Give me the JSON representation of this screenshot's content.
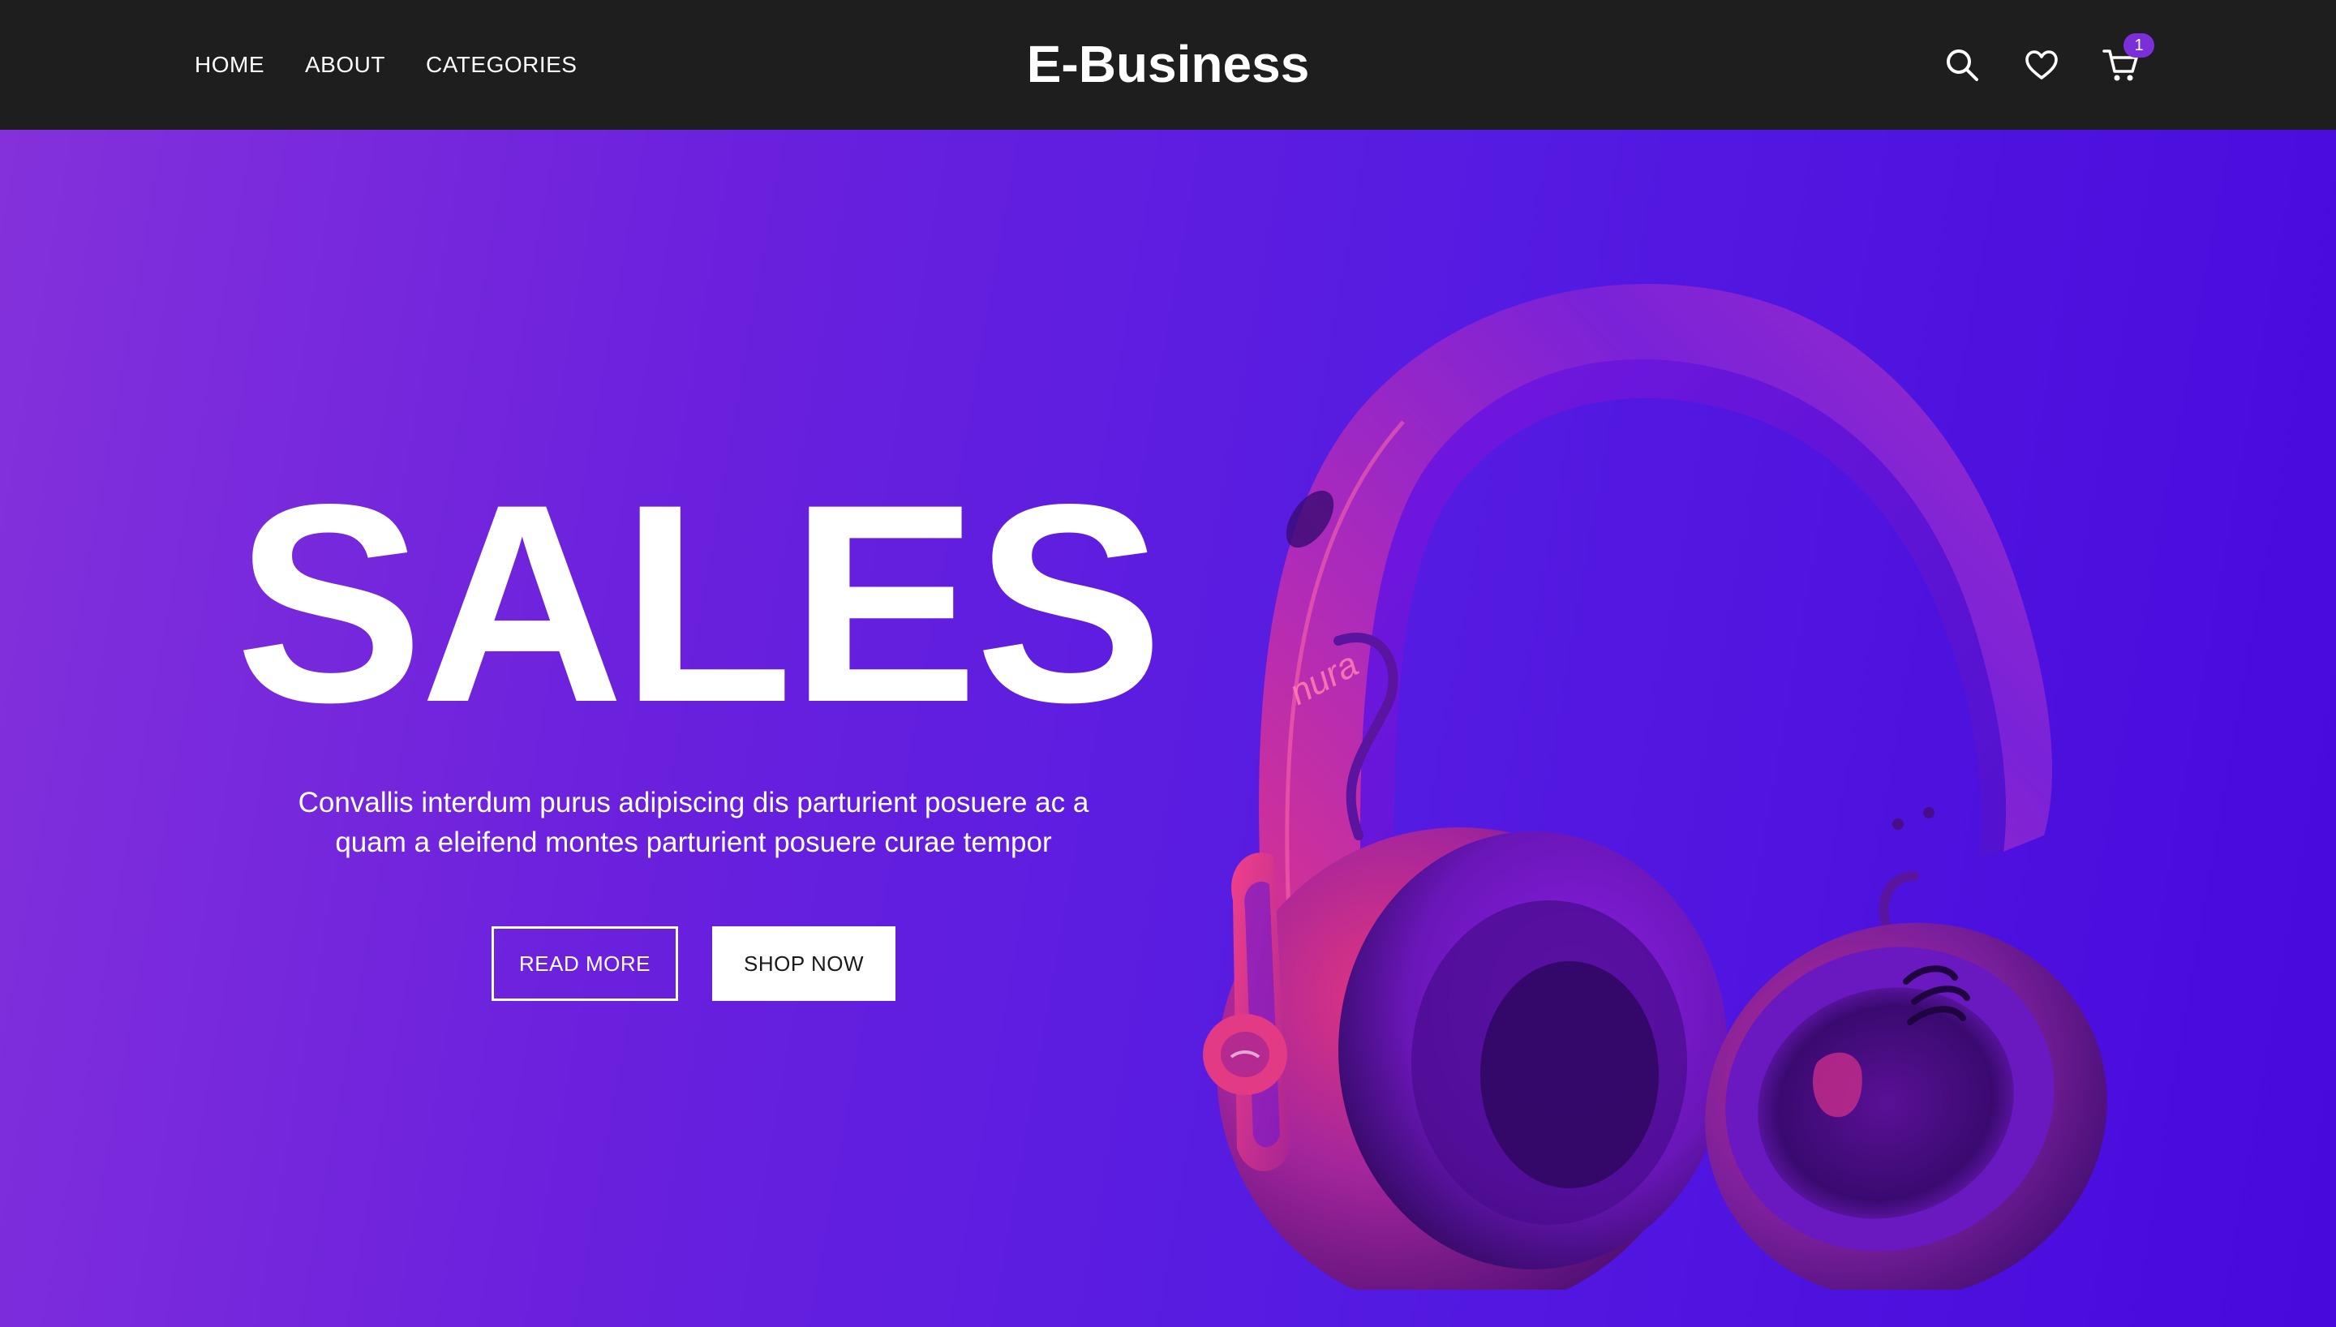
{
  "header": {
    "nav": [
      {
        "label": "HOME"
      },
      {
        "label": "ABOUT"
      },
      {
        "label": "CATEGORIES"
      }
    ],
    "brand": "E-Business",
    "icons": [
      "search-icon",
      "heart-icon",
      "cart-icon"
    ],
    "cart_count": "1"
  },
  "hero": {
    "headline": "SALES",
    "tagline": "Convallis interdum purus adipiscing dis parturient posuere ac a quam a eleifend montes parturient posuere curae tempor",
    "read_more_label": "READ MORE",
    "shop_now_label": "SHOP NOW",
    "product_logo": "nura"
  },
  "colors": {
    "header_bg": "#1e1e1e",
    "hero_gradient_start": "#8431db",
    "hero_gradient_end": "#4809dc",
    "badge": "#7b2fd8",
    "headphone_pink": "#e0357a",
    "headphone_purple": "#7a17e6"
  }
}
